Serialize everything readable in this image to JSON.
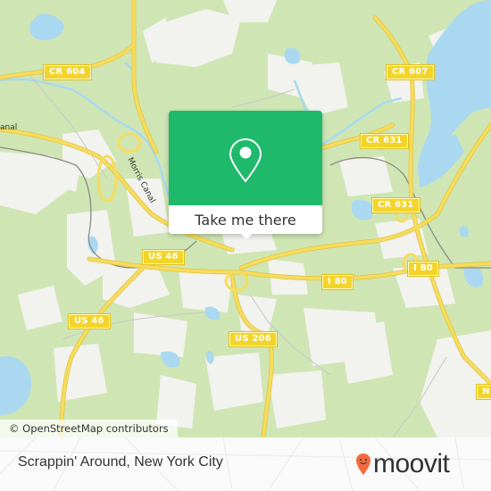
{
  "map": {
    "road_labels": [
      {
        "id": "cr604",
        "label": "CR 604"
      },
      {
        "id": "cr607",
        "label": "CR 607"
      },
      {
        "id": "cr631a",
        "label": "CR 631"
      },
      {
        "id": "cr631b",
        "label": "CR 631"
      },
      {
        "id": "us46a",
        "label": "US 46"
      },
      {
        "id": "us46b",
        "label": "US 46"
      },
      {
        "id": "i80a",
        "label": "I 80"
      },
      {
        "id": "i80b",
        "label": "I 80"
      },
      {
        "id": "us206",
        "label": "US 206"
      },
      {
        "id": "n-edge",
        "label": "N"
      }
    ],
    "water_labels": [
      {
        "id": "morris-canal",
        "label": "Morris Canal"
      },
      {
        "id": "canal-left",
        "label": "anal"
      }
    ],
    "attribution": "© OpenStreetMap contributors",
    "colors": {
      "land": "#cfe6b4",
      "urban": "#f2f2ef",
      "water": "#a9d8f0",
      "road": "#f6dc5e",
      "shield": "#f3d42a"
    }
  },
  "popup": {
    "icon": "map-pin-icon",
    "button_label": "Take me there",
    "color": "#1fb96b"
  },
  "footer": {
    "place_name": "Scrappin' Around, New York City",
    "brand": "moovit",
    "brand_color": "#f26a3d"
  }
}
